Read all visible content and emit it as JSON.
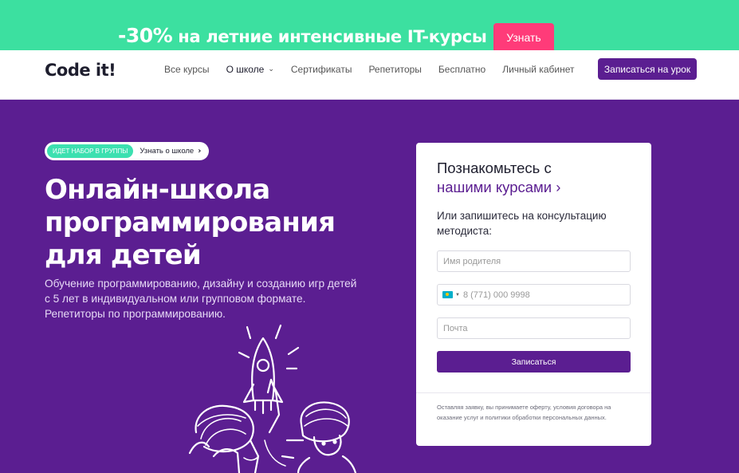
{
  "promo": {
    "discount": "-30%",
    "text": " на летние интенсивные IT-курсы",
    "button_label": "Узнать",
    "bg_color": "#3ce0a0",
    "button_color": "#ff3b79"
  },
  "header": {
    "logo": "Code it!",
    "nav": [
      {
        "label": "Все курсы"
      },
      {
        "label": "О школе",
        "has_dropdown": true,
        "icon": "chevron-down-icon"
      },
      {
        "label": "Сертификаты"
      },
      {
        "label": "Репетиторы"
      },
      {
        "label": "Бесплатно"
      },
      {
        "label": "Личный кабинет"
      }
    ],
    "cta_label": "Записаться на урок"
  },
  "hero": {
    "badge_tag": "ИДЕТ НАБОР В ГРУППЫ",
    "badge_link": "Узнать о школе",
    "badge_arrow": "›",
    "title_lines": [
      "Онлайн-школа",
      "программирования",
      "для детей"
    ],
    "subtitle_lines": [
      "Обучение программированию, дизайну и созданию игр детей",
      "с 5 лет в индивидуальном или групповом формате.",
      "Репетиторы по программированию."
    ],
    "bg_color": "#5b1e91"
  },
  "form": {
    "title": "Познакомьтесь с",
    "link": "нашими курсами ›",
    "subtitle": "Или запишитесь на консультацию методиста:",
    "name_placeholder": "Имя родителя",
    "phone_placeholder": "8 (771) 000 9998",
    "phone_flag": "kz-flag-icon",
    "email_placeholder": "Почта",
    "submit_label": "Записаться",
    "legal": "Оставляя заявку, вы принимаете оферту, условия договора на оказание услуг и политики обработки персональных данных."
  }
}
